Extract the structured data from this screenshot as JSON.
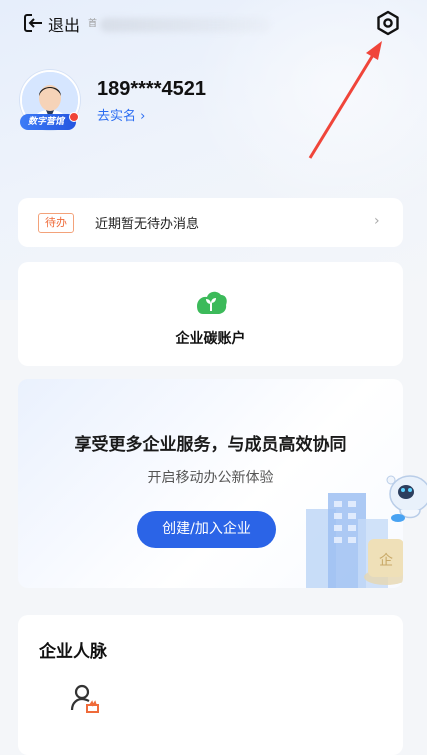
{
  "topbar": {
    "logout_label": "退出",
    "home_label": "首"
  },
  "profile": {
    "phone": "189****4521",
    "verify_link": "去实名 ›",
    "avatar_badge": "数字营馆"
  },
  "todo": {
    "tag": "待办",
    "message": "近期暂无待办消息",
    "chevron": "›"
  },
  "carbon": {
    "label": "企业碳账户"
  },
  "promo": {
    "title": "享受更多企业服务，与成员高效协同",
    "subtitle": "开启移动办公新体验",
    "button": "创建/加入企业",
    "building_glyph": "企"
  },
  "network": {
    "title": "企业人脉"
  },
  "colors": {
    "accent": "#2b64e7",
    "annotation_arrow": "#f0453a",
    "todo_tag": "#ef6b3a",
    "carbon_icon": "#3cba5a"
  }
}
